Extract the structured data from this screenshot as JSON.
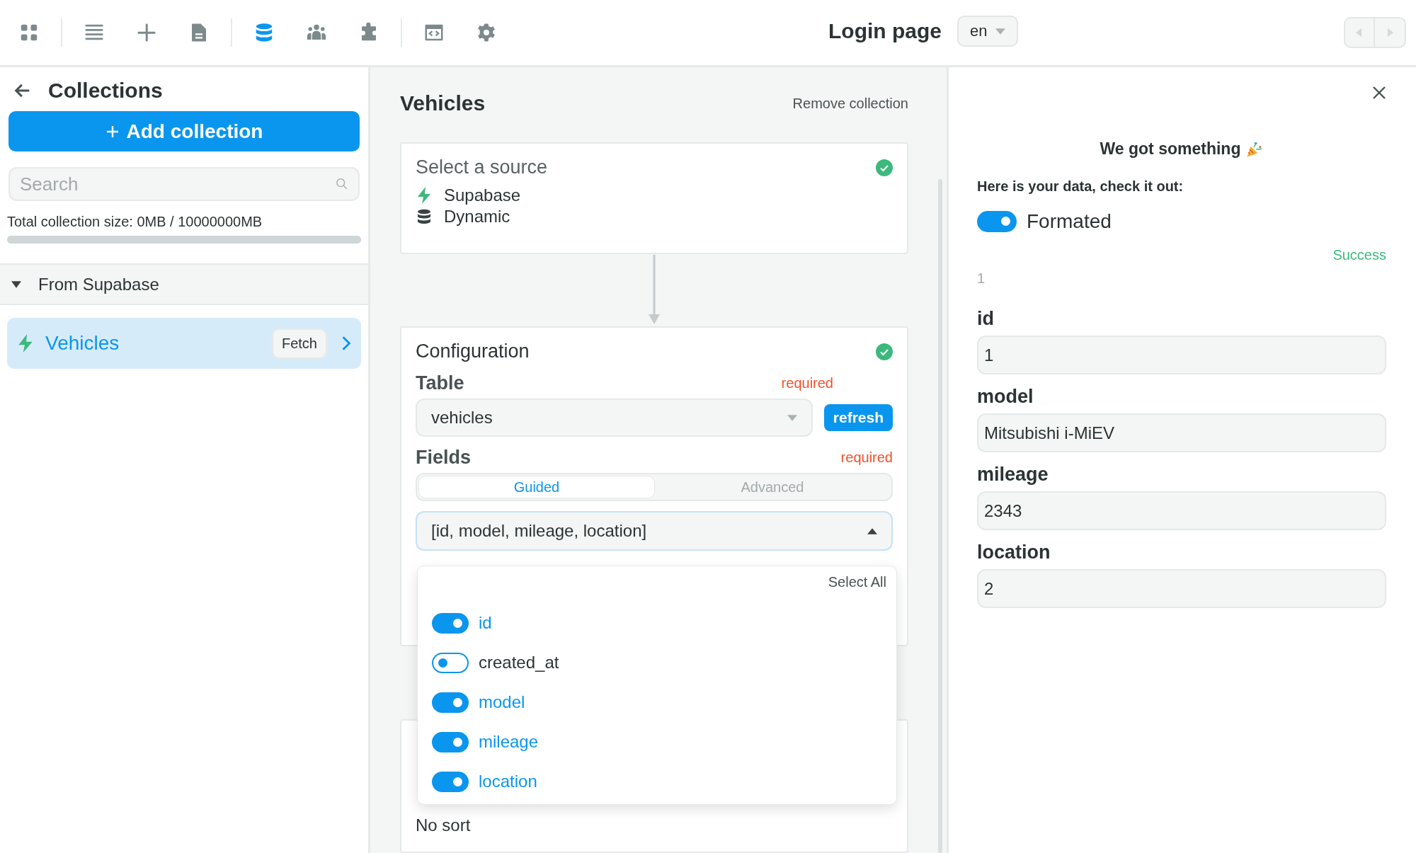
{
  "toolbar": {
    "groups": [
      [
        {
          "selected": false
        }
      ],
      [
        {
          "selected": false
        },
        {
          "selected": false
        },
        {
          "selected": false
        }
      ],
      [
        {
          "selected": true
        },
        {
          "selected": false
        },
        {
          "selected": false
        }
      ],
      [
        {
          "selected": false
        },
        {
          "selected": false
        }
      ]
    ]
  },
  "page_title": "Login page",
  "language": "en",
  "sidebar": {
    "title": "Collections",
    "add_button": "Add collection",
    "search": {
      "placeholder": "Search"
    },
    "size_text": "Total collection size: 0MB / 10000000MB",
    "usage": {
      "level": 0
    },
    "groups": [
      {
        "label": "From Supabase",
        "expanded": true,
        "items": [
          {
            "label": "Vehicles",
            "badge": "Fetch",
            "selected": true
          }
        ]
      }
    ]
  },
  "editor": {
    "title": "Vehicles",
    "remove": "Remove collection",
    "source_card": {
      "title": "Select a source",
      "done": true,
      "lines": [
        {
          "kind": "supabase",
          "label": "Supabase"
        },
        {
          "kind": "dynamic",
          "label": "Dynamic"
        }
      ]
    },
    "config_card": {
      "title": "Configuration",
      "done": true,
      "table": {
        "label": "Table",
        "required": "required",
        "value": "vehicles",
        "refresh": "refresh"
      },
      "fields": {
        "label": "Fields",
        "required": "required",
        "modes": [
          {
            "label": "Guided",
            "selected": true
          },
          {
            "label": "Advanced",
            "selected": false
          }
        ],
        "value": "[id, model, mileage, location]",
        "expanded": true,
        "select_all": "Select All",
        "options": [
          {
            "label": "id",
            "on": true
          },
          {
            "label": "created_at",
            "on": false
          },
          {
            "label": "model",
            "on": true
          },
          {
            "label": "mileage",
            "on": true
          },
          {
            "label": "location",
            "on": true
          }
        ]
      }
    },
    "summary_card": {
      "lines": [
        "No sort"
      ]
    }
  },
  "result": {
    "heading": "We got something",
    "intro": "Here is your data, check it out:",
    "formatted": {
      "label": "Formated",
      "on": true
    },
    "status": "Success",
    "index": "1",
    "fields": [
      {
        "label": "id",
        "value": "1"
      },
      {
        "label": "model",
        "value": "Mitsubishi i-MiEV"
      },
      {
        "label": "mileage",
        "value": "2343"
      },
      {
        "label": "location",
        "value": "2"
      }
    ]
  }
}
